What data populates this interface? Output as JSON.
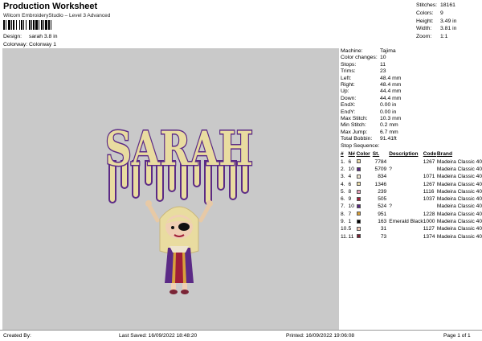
{
  "header": {
    "title": "Production Worksheet",
    "subtitle": "Wilcom EmbroideryStudio – Level 3 Advanced",
    "design_label": "Design:",
    "design_value": "sarah 3.8 in",
    "colorway_label": "Colorway:",
    "colorway_value": "Colorway 1"
  },
  "summary": [
    {
      "label": "Stitches:",
      "value": "18161"
    },
    {
      "label": "Colors:",
      "value": "9"
    },
    {
      "label": "Height:",
      "value": "3.49 in"
    },
    {
      "label": "Width:",
      "value": "3.81 in"
    },
    {
      "label": "Zoom:",
      "value": "1:1"
    }
  ],
  "design_text": "SARAH",
  "machine_info": [
    {
      "label": "Machine:",
      "value": "Tajima"
    },
    {
      "label": "Color changes:",
      "value": "10"
    },
    {
      "label": "Stops:",
      "value": "11"
    },
    {
      "label": "Trims:",
      "value": "23"
    },
    {
      "label": "Left:",
      "value": "48.4 mm"
    },
    {
      "label": "Right:",
      "value": "48.4 mm"
    },
    {
      "label": "Up:",
      "value": "44.4 mm"
    },
    {
      "label": "Down:",
      "value": "44.4 mm"
    },
    {
      "label": "EndX:",
      "value": "0.00 in"
    },
    {
      "label": "EndY:",
      "value": "0.00 in"
    },
    {
      "label": "Max Stitch:",
      "value": "10.3 mm"
    },
    {
      "label": "Min Stitch:",
      "value": "0.2 mm"
    },
    {
      "label": "Max Jump:",
      "value": "6.7 mm"
    },
    {
      "label": "Total Bobbin:",
      "value": "91.41ft"
    }
  ],
  "stop_sequence": {
    "label": "Stop Sequence:",
    "columns": [
      "#",
      "N#",
      "Color",
      "St.",
      "Description",
      "Code",
      "Brand"
    ],
    "rows": [
      {
        "n": "1.",
        "needle": "6",
        "color": "#e8d9a8",
        "stitches": "7784",
        "desc": "",
        "code": "1267",
        "brand": "Madeira Classic 40"
      },
      {
        "n": "2.",
        "needle": "10",
        "color": "#5a2a82",
        "stitches": "5709",
        "desc": "?",
        "code": "",
        "brand": "Madeira Classic 40"
      },
      {
        "n": "3.",
        "needle": "4",
        "color": "#eee4cf",
        "stitches": "834",
        "desc": "",
        "code": "1071",
        "brand": "Madeira Classic 40"
      },
      {
        "n": "4.",
        "needle": "6",
        "color": "#e8d9a8",
        "stitches": "1346",
        "desc": "",
        "code": "1267",
        "brand": "Madeira Classic 40"
      },
      {
        "n": "5.",
        "needle": "8",
        "color": "#e39fb6",
        "stitches": "239",
        "desc": "",
        "code": "1116",
        "brand": "Madeira Classic 40"
      },
      {
        "n": "6.",
        "needle": "9",
        "color": "#a01e38",
        "stitches": "505",
        "desc": "",
        "code": "1037",
        "brand": "Madeira Classic 40"
      },
      {
        "n": "7.",
        "needle": "10",
        "color": "#5a2a82",
        "stitches": "524",
        "desc": "?",
        "code": "",
        "brand": "Madeira Classic 40"
      },
      {
        "n": "8.",
        "needle": "7",
        "color": "#d8a03a",
        "stitches": "951",
        "desc": "",
        "code": "1228",
        "brand": "Madeira Classic 40"
      },
      {
        "n": "9.",
        "needle": "1",
        "color": "#000000",
        "stitches": "163",
        "desc": "Emerald Black",
        "code": "1000",
        "brand": "Madeira Classic 40"
      },
      {
        "n": "10.",
        "needle": "5",
        "color": "#f1c9b5",
        "stitches": "31",
        "desc": "",
        "code": "1127",
        "brand": "Madeira Classic 40"
      },
      {
        "n": "11.",
        "needle": "11",
        "color": "#7a2436",
        "stitches": "73",
        "desc": "",
        "code": "1374",
        "brand": "Madeira Classic 40"
      }
    ]
  },
  "footer": {
    "created_by": "Created By:",
    "last_saved": "Last Saved: 16/09/2022 18:48:20",
    "printed": "Printed: 16/09/2022 19:06:08",
    "page": "Page 1 of 1"
  }
}
